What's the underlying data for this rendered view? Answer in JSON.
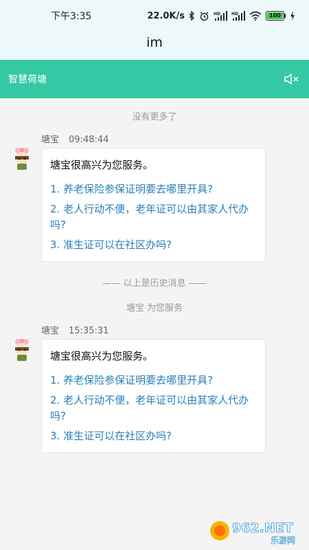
{
  "status_bar": {
    "time": "下午3:35",
    "net_speed": "22.0K/s",
    "battery": "100"
  },
  "app_title": "im",
  "header": {
    "title": "智慧荷塘"
  },
  "chat": {
    "no_more": "没有更多了",
    "history_divider": "—— 以上是历史消息 ——",
    "service_note": "塘宝 为您服务",
    "messages": [
      {
        "sender": "塘宝",
        "time": "09:48:44",
        "greeting": "塘宝很高兴为您服务。",
        "questions": [
          "1. 养老保险参保证明要去哪里开具?",
          "2. 老人行动不便，老年证可以由其家人代办吗?",
          "3. 准生证可以在社区办吗?"
        ]
      },
      {
        "sender": "塘宝",
        "time": "15:35:31",
        "greeting": "塘宝很高兴为您服务。",
        "questions": [
          "1. 养老保险参保证明要去哪里开具?",
          "2. 老人行动不便，老年证可以由其家人代办吗?",
          "3. 准生证可以在社区办吗?"
        ]
      }
    ]
  },
  "watermark": {
    "brand": "962.NET",
    "site": "乐游网"
  },
  "colors": {
    "accent": "#35c8a4",
    "link": "#2a7fb9",
    "top_bg": "#edf8fb",
    "page_bg": "#f4f4f4"
  }
}
